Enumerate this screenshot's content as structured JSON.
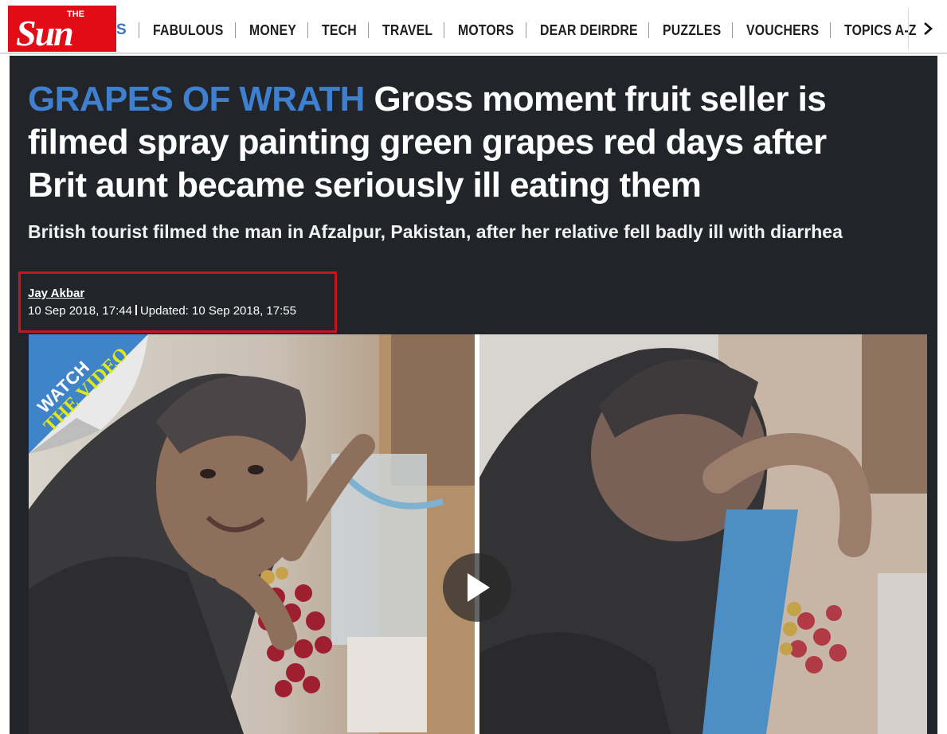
{
  "nav": {
    "logo_text": "Sun",
    "logo_small": "THE",
    "cut_item": "S",
    "items": [
      {
        "label": "FABULOUS"
      },
      {
        "label": "MONEY"
      },
      {
        "label": "TECH"
      },
      {
        "label": "TRAVEL"
      },
      {
        "label": "MOTORS"
      },
      {
        "label": "DEAR DEIRDRE"
      },
      {
        "label": "PUZZLES"
      },
      {
        "label": "VOUCHERS"
      },
      {
        "label": "TOPICS A-Z"
      }
    ],
    "more_icon": "chevron-right-icon"
  },
  "article": {
    "kicker": "GRAPES OF WRATH",
    "headline": "Gross moment fruit seller is filmed spray painting green grapes red days after Brit aunt became seriously ill eating them",
    "standfirst": "British tourist filmed the man in Afzalpur, Pakistan, after her relative fell badly ill with diarrhea",
    "author": "Jay Akbar",
    "published": "10 Sep 2018, 17:44",
    "updated": "Updated: 10 Sep 2018, 17:55"
  },
  "video": {
    "badge_line1": "WATCH",
    "badge_line2": "THE VIDEO",
    "play_icon": "play-icon"
  },
  "colors": {
    "brand_red": "#e20c17",
    "kicker_blue": "#3f7fcf",
    "panel_bg": "#212529",
    "highlight_border": "#c8141b",
    "badge_yellow": "#e3e81b"
  }
}
